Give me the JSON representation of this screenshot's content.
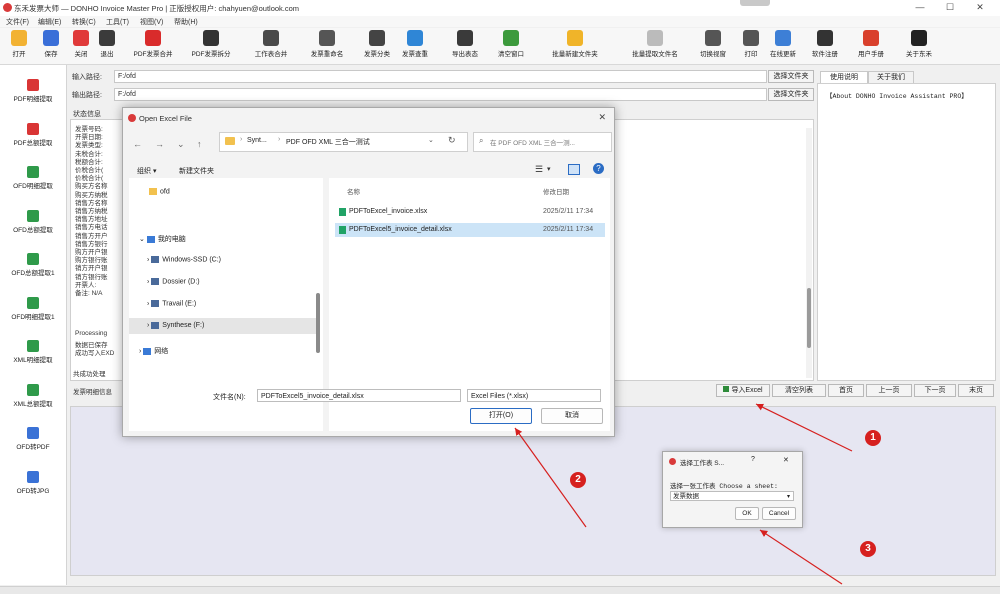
{
  "window": {
    "title": "东禾发票大师 — DONHO Invoice Master Pro | 正版授权用户:  chahyuen@outlook.com",
    "minimize": "—",
    "maximize": "☐",
    "close": "✕"
  },
  "menu": [
    "文件(F)",
    "编辑(E)",
    "转换(C)",
    "工具(T)",
    "视图(V)",
    "帮助(H)"
  ],
  "toolbar": [
    {
      "label": "打开",
      "icon": "folder-open-icon",
      "color": "#f2b233"
    },
    {
      "label": "保存",
      "icon": "save-icon",
      "color": "#3a6fd8"
    },
    {
      "label": "关闭",
      "icon": "close-circle-icon",
      "color": "#e03a3a"
    },
    {
      "label": "退出",
      "icon": "exit-icon",
      "color": "#3b3b3b"
    },
    {
      "label": "PDF发票合并",
      "icon": "pdf-merge-icon",
      "color": "#d92b2b"
    },
    {
      "label": "PDF发票拆分",
      "icon": "pdf-split-icon",
      "color": "#333333"
    },
    {
      "label": "工作表合并",
      "icon": "sheet-merge-icon",
      "color": "#4a4a4a"
    },
    {
      "label": "发票重命名",
      "icon": "rename-icon",
      "color": "#555555"
    },
    {
      "label": "发票分类",
      "icon": "grid-icon",
      "color": "#444444"
    },
    {
      "label": "发票查重",
      "icon": "duplicate-check-icon",
      "color": "#2f86d6"
    },
    {
      "label": "导出表态",
      "icon": "calendar-icon",
      "color": "#3a3a3a"
    },
    {
      "label": "清空窗口",
      "icon": "clear-icon",
      "color": "#3c9a3c"
    },
    {
      "label": "批量新建文件夹",
      "icon": "new-folder-icon",
      "color": "#f0b429"
    },
    {
      "label": "批量提取文件名",
      "icon": "extract-names-icon",
      "color": "#bbbbbb"
    },
    {
      "label": "切换视窗",
      "icon": "switch-view-icon",
      "color": "#555555"
    },
    {
      "label": "打印",
      "icon": "print-icon",
      "color": "#555555"
    },
    {
      "label": "在线更新",
      "icon": "update-icon",
      "color": "#3d7fd6"
    },
    {
      "label": "软件注册",
      "icon": "register-icon",
      "color": "#333333"
    },
    {
      "label": "用户手册",
      "icon": "manual-icon",
      "color": "#d9402c"
    },
    {
      "label": "关于东禾",
      "icon": "about-icon",
      "color": "#222222"
    }
  ],
  "sidebar": [
    {
      "label": "PDF明细提取",
      "icon": "pdf-detail-icon",
      "color": "#d93535"
    },
    {
      "label": "PDF总额提取",
      "icon": "pdf-total-icon",
      "color": "#d93535"
    },
    {
      "label": "OFD明细提取",
      "icon": "ofd-detail-icon",
      "color": "#2f9a4a"
    },
    {
      "label": "OFD总额提取",
      "icon": "ofd-total-icon",
      "color": "#2f9a4a"
    },
    {
      "label": "OFD总额提取1",
      "icon": "ofd-total1-icon",
      "color": "#2f9a4a"
    },
    {
      "label": "OFD明细提取1",
      "icon": "ofd-detail1-icon",
      "color": "#2f9a4a"
    },
    {
      "label": "XML明细提取",
      "icon": "xml-detail-icon",
      "color": "#2f9a4a"
    },
    {
      "label": "XML总额提取",
      "icon": "xml-total-icon",
      "color": "#2f9a4a"
    },
    {
      "label": "OFD转PDF",
      "icon": "ofd-to-pdf-icon",
      "color": "#3a72d6"
    },
    {
      "label": "OFD转JPG",
      "icon": "ofd-to-jpg-icon",
      "color": "#3a72d6"
    }
  ],
  "paths": {
    "input_label": "输入路径:",
    "input_value": "F:/ofd",
    "output_label": "输出路径:",
    "output_value": "F:/ofd",
    "select_folder": "选择文件夹"
  },
  "status": {
    "label": "状态信息",
    "lines": [
      "发票号码: ",
      "开票日期: ",
      "发票类型: ",
      "未税合计: ",
      "税额合计: ",
      "价税合计(",
      "价税合计(",
      "购买方名称",
      "购买方纳税",
      "销售方名称",
      "销售方纳税",
      "销售方地址",
      "销售方电话",
      "销售方开户",
      "销售方银行",
      "购方开户银",
      "购方银行账",
      "销方开户银",
      "销方银行账",
      "开票人: ",
      "备注: N/A"
    ],
    "processing": [
      "Processing",
      "数据已保存",
      "成功写入EXD"
    ],
    "summary": "共成功处理",
    "detail_info": "发票明细信息"
  },
  "right_panel": {
    "tabs": [
      "使用说明",
      "关于我们"
    ],
    "text": "【About DONHO Invoice Assistant PRO】"
  },
  "actions": {
    "import_excel": "导入Excel",
    "clear_list": "清空列表",
    "home": "首页",
    "prev": "上一页",
    "next": "下一页",
    "last": "末页"
  },
  "dialog": {
    "title": "Open Excel File",
    "breadcrumb": [
      "Synt...",
      "PDF OFD XML 三合一测试"
    ],
    "search_placeholder": "在 PDF OFD XML 三合一测...",
    "organize": "组织 ▾",
    "new_folder": "新建文件夹",
    "nav": [
      {
        "label": "ofd",
        "type": "folder"
      },
      {
        "label": "我的电脑",
        "type": "pc"
      },
      {
        "label": "Windows-SSD (C:)",
        "type": "drive"
      },
      {
        "label": "Dossier (D:)",
        "type": "drive"
      },
      {
        "label": "Travail (E:)",
        "type": "drive"
      },
      {
        "label": "Synthese (F:)",
        "type": "drive"
      },
      {
        "label": "网络",
        "type": "network"
      }
    ],
    "columns": {
      "name": "名称",
      "date": "修改日期"
    },
    "files": [
      {
        "name": "PDFToExcel_invoice.xlsx",
        "date": "2025/2/11 17:34"
      },
      {
        "name": "PDFToExcel5_invoice_detail.xlsx",
        "date": "2025/2/11 17:34"
      }
    ],
    "filename_label": "文件名(N):",
    "filename_value": "PDFToExcel5_invoice_detail.xlsx",
    "filetype": "Excel Files (*.xlsx)",
    "open": "打开(O)",
    "cancel": "取消"
  },
  "sheet_dialog": {
    "title": "选择工作表 S...",
    "help": "?",
    "close": "✕",
    "prompt": "选择一张工作表 Choose a sheet:",
    "selected": "发票数据",
    "ok": "OK",
    "cancel": "Cancel"
  },
  "badges": [
    "1",
    "2",
    "3"
  ],
  "colors": {
    "accent_red": "#d6201f",
    "selection": "#cce4f7",
    "link_blue": "#2b6cc4"
  }
}
